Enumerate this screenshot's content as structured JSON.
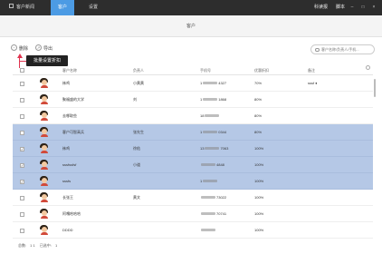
{
  "topbar": {
    "app_title": "客户新闻",
    "nav": [
      {
        "label": "客户",
        "active": true
      },
      {
        "label": "设置",
        "active": false
      }
    ],
    "right": [
      "科读报",
      "脚本"
    ]
  },
  "page": {
    "title": "客户"
  },
  "toolbar": {
    "delete_label": "删除",
    "export_label": "导出",
    "search_placeholder": "客户名称/负责人/手机..."
  },
  "tooltip": {
    "text": "批量设置折扣"
  },
  "table": {
    "headers": [
      "客户名称",
      "负责人",
      "手机号",
      "优惠折扣",
      "备注"
    ],
    "rows": [
      {
        "name": "袜鸡",
        "owner": "小黄黄",
        "phone_a": "1",
        "phone_b": "4327",
        "discount": "70%",
        "note": "sssf",
        "note_mark": "♦",
        "selected": false,
        "checked": false
      },
      {
        "name": "聚福盛的大学",
        "owner": "刘",
        "phone_a": "1",
        "phone_b": "1868",
        "discount": "80%",
        "note": "",
        "note_mark": "",
        "selected": false,
        "checked": false
      },
      {
        "name": "去哪取些",
        "owner": "",
        "phone_a": "18",
        "phone_b": "",
        "discount": "80%",
        "note": "",
        "note_mark": "",
        "selected": false,
        "checked": false
      },
      {
        "name": "客户可智高兵",
        "owner": "张先生",
        "phone_a": "1",
        "phone_b": "0344",
        "discount": "80%",
        "note": "",
        "note_mark": "",
        "selected": true,
        "checked": false
      },
      {
        "name": "袜鸡",
        "owner": "徐佑",
        "phone_a": "13",
        "phone_b": "7063",
        "discount": "100%",
        "note": "",
        "note_mark": "",
        "selected": true,
        "checked": true
      },
      {
        "name": "sssfssfsf",
        "owner": "小道",
        "phone_a": "",
        "phone_b": "4848",
        "discount": "100%",
        "note": "",
        "note_mark": "",
        "selected": true,
        "checked": true
      },
      {
        "name": "sssfs",
        "owner": "",
        "phone_a": "1",
        "phone_b": "",
        "discount": "100%",
        "note": "",
        "note_mark": "",
        "selected": true,
        "checked": true
      },
      {
        "name": "长张王",
        "owner": "黄文",
        "phone_a": "",
        "phone_b": "73022",
        "discount": "100%",
        "note": "",
        "note_mark": "",
        "selected": false,
        "checked": false
      },
      {
        "name": "阿嘎哈哈哈",
        "owner": "",
        "phone_a": "",
        "phone_b": "70741",
        "discount": "100%",
        "note": "",
        "note_mark": "",
        "selected": false,
        "checked": false
      },
      {
        "name": "DDDD",
        "owner": "",
        "phone_a": "",
        "phone_b": "",
        "discount": "100%",
        "note": "",
        "note_mark": "",
        "selected": false,
        "checked": false
      }
    ]
  },
  "footer": {
    "total_label": "总数:",
    "total_value": "1 1",
    "selected_label": "已选中:",
    "selected_value": "1"
  },
  "colors": {
    "topbar": "#2d2d2d",
    "accent": "#4c9be4",
    "selected_row": "#b5c8e6",
    "annotation": "#e0334f"
  }
}
